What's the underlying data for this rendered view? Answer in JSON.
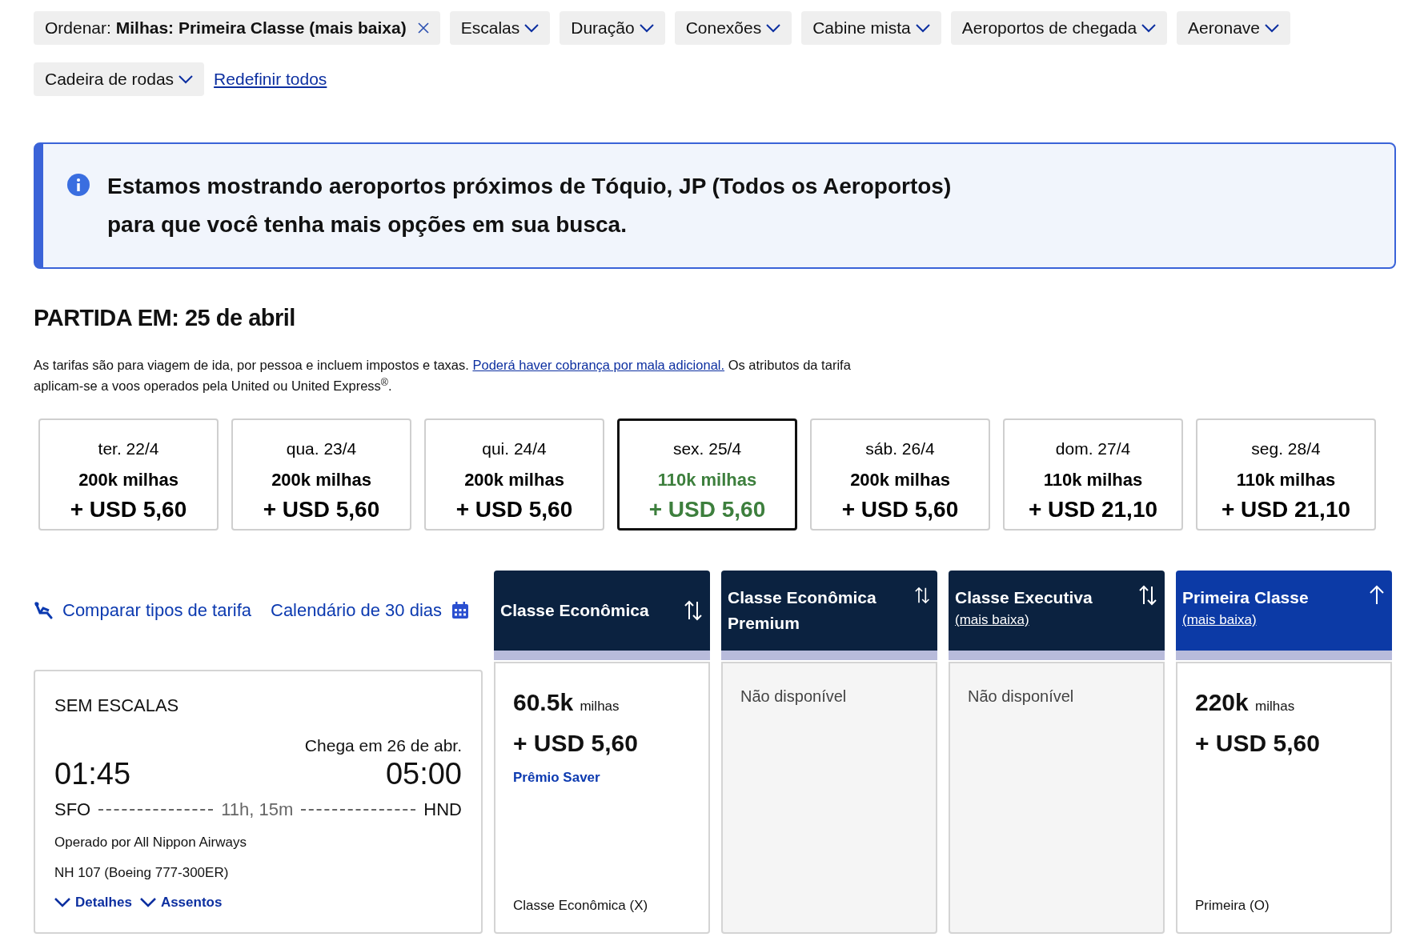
{
  "filters": {
    "sort": {
      "label": "Ordenar:",
      "value": "Milhas: Primeira Classe (mais baixa)"
    },
    "dropdowns": [
      "Escalas",
      "Duração",
      "Conexões",
      "Cabine mista",
      "Aeroportos de chegada",
      "Aeronave",
      "Cadeira de rodas"
    ],
    "reset": "Redefinir todos"
  },
  "notice": "Estamos mostrando aeroportos próximos de Tóquio, JP (Todos os Aeroportos) para que você tenha mais opções em sua busca.",
  "heading": "PARTIDA EM: 25 de abril",
  "fare_note": {
    "before": "As tarifas são para viagem de ida, por pessoa e incluem impostos e taxas.",
    "link": "Poderá haver cobrança por mala adicional.",
    "after": "Os atributos da tarifa aplicam-se a voos operados pela United ou United Express$^{®}$."
  },
  "dates": [
    {
      "day": "ter. 22/4",
      "miles": "200k milhas",
      "price": "+ USD 5,60",
      "selected": false
    },
    {
      "day": "qua. 23/4",
      "miles": "200k milhas",
      "price": "+ USD 5,60",
      "selected": false
    },
    {
      "day": "qui. 24/4",
      "miles": "200k milhas",
      "price": "+ USD 5,60",
      "selected": false
    },
    {
      "day": "sex. 25/4",
      "miles": "110k milhas",
      "price": "+ USD 5,60",
      "selected": true
    },
    {
      "day": "sáb. 26/4",
      "miles": "200k milhas",
      "price": "+ USD 5,60",
      "selected": false
    },
    {
      "day": "dom. 27/4",
      "miles": "110k milhas",
      "price": "+ USD 21,10",
      "selected": false
    },
    {
      "day": "seg. 28/4",
      "miles": "110k milhas",
      "price": "+ USD 21,10",
      "selected": false
    }
  ],
  "tools": {
    "compare": "Comparar tipos de tarifa",
    "calendar": "Calendário de 30 dias"
  },
  "flight": {
    "stops": "SEM ESCALAS",
    "arrival_note": "Chega em 26 de abr.",
    "depart_time": "01:45",
    "arrive_time": "05:00",
    "origin": "SFO",
    "destination": "HND",
    "duration": "11h, 15m",
    "operator": "Operado por All Nippon Airways",
    "flight_number": "NH 107 (Boeing 777-300ER)",
    "links": [
      "Detalhes",
      "Assentos"
    ]
  },
  "fare_columns": [
    {
      "title": "Classe Econômica",
      "sorted": false,
      "selected": false,
      "cell": {
        "kind": "price",
        "miles": "60.5k",
        "unit": "milhas",
        "price": "+ USD 5,60",
        "tag": "Prêmio Saver",
        "fare_class": "Classe Econômica (X)"
      }
    },
    {
      "title": "Classe Econômica Premium",
      "sorted": false,
      "selected": false,
      "cell": {
        "kind": "unavailable",
        "text": "Não disponível"
      }
    },
    {
      "title": "Classe Executiva",
      "subtitle": "(mais baixa)",
      "sorted": false,
      "selected": false,
      "cell": {
        "kind": "unavailable",
        "text": "Não disponível"
      }
    },
    {
      "title": "Primeira Classe",
      "subtitle": "(mais baixa)",
      "sorted": true,
      "selected": true,
      "cell": {
        "kind": "price",
        "miles": "220k",
        "unit": "milhas",
        "price": "+ USD 5,60",
        "fare_class": "Primeira (O)"
      }
    }
  ]
}
